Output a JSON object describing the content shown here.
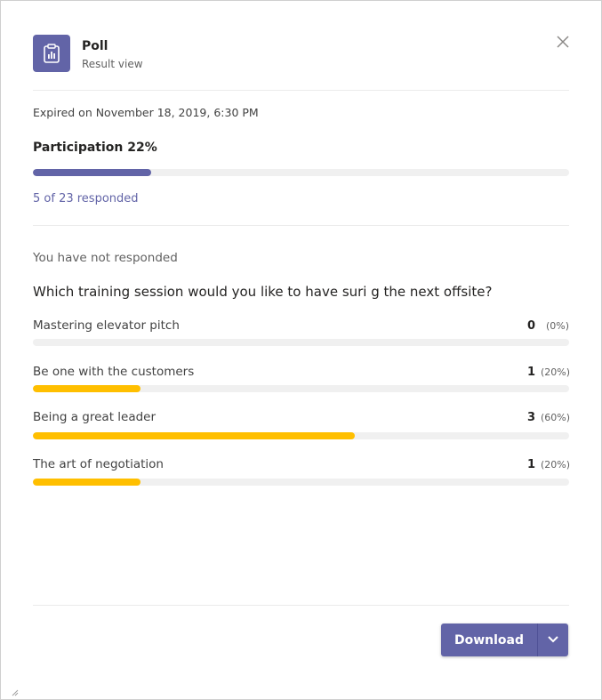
{
  "header": {
    "title": "Poll",
    "subtitle": "Result view",
    "app_icon": "clipboard-chart-icon",
    "close_icon": "close-icon"
  },
  "status": {
    "expired": "Expired on November 18, 2019, 6:30 PM",
    "participation_label": "Participation 22%",
    "participation_fraction": 0.22,
    "responded_link": "5 of 23 responded",
    "not_responded": "You have not responded"
  },
  "poll": {
    "question": "Which training session would you like to have suri g the next offsite?",
    "options": [
      {
        "label": "Mastering elevator pitch",
        "count": "0",
        "percent": "(0%)",
        "fraction": 0.0
      },
      {
        "label": "Be one with the customers",
        "count": "1",
        "percent": "(20%)",
        "fraction": 0.2
      },
      {
        "label": "Being a great leader",
        "count": "3",
        "percent": "(60%)",
        "fraction": 0.6
      },
      {
        "label": "The art of negotiation",
        "count": "1",
        "percent": "(20%)",
        "fraction": 0.2
      }
    ]
  },
  "footer": {
    "download_label": "Download",
    "dropdown_icon": "chevron-down-icon"
  },
  "colors": {
    "accent": "#6264a7",
    "bar_fill": "#ffbf00",
    "track": "#f0f0f0"
  }
}
